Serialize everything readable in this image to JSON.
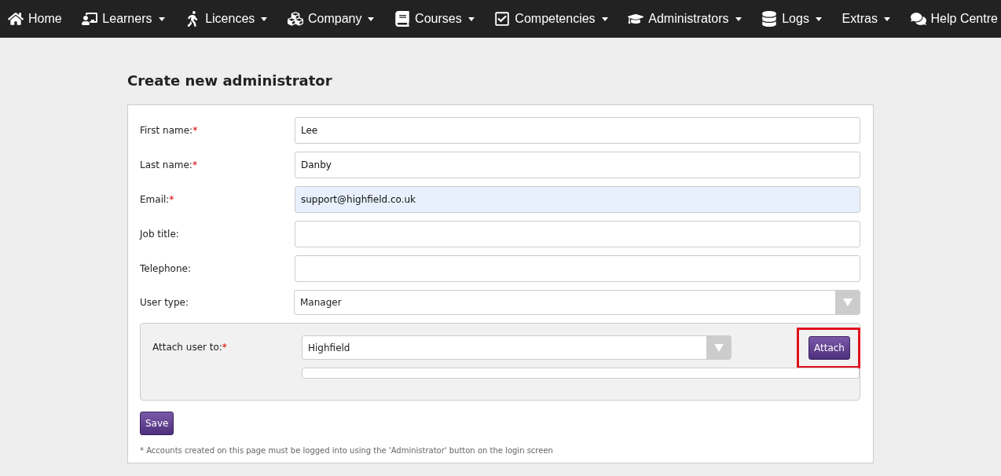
{
  "nav": [
    {
      "label": "Home",
      "dropdown": false
    },
    {
      "label": "Learners",
      "dropdown": true
    },
    {
      "label": "Licences",
      "dropdown": true
    },
    {
      "label": "Company",
      "dropdown": true
    },
    {
      "label": "Courses",
      "dropdown": true
    },
    {
      "label": "Competencies",
      "dropdown": true
    },
    {
      "label": "Administrators",
      "dropdown": true
    },
    {
      "label": "Logs",
      "dropdown": true
    },
    {
      "label": "Extras",
      "dropdown": true
    },
    {
      "label": "Help Centre",
      "dropdown": false
    }
  ],
  "title": "Create new administrator",
  "fields": [
    {
      "kind": "text",
      "label": "First name:",
      "required_mark": "*",
      "value": "Lee",
      "autofilled": false
    },
    {
      "kind": "text",
      "label": "Last name:",
      "required_mark": "*",
      "value": "Danby",
      "autofilled": false
    },
    {
      "kind": "text",
      "label": "Email:",
      "required_mark": "*",
      "value": "support@highfield.co.uk",
      "autofilled": true
    },
    {
      "kind": "text",
      "label": "Job title:",
      "autofilled": false
    },
    {
      "kind": "text",
      "label": "Telephone:",
      "autofilled": false
    },
    {
      "kind": "select",
      "label": "User type:",
      "value": "Manager"
    }
  ],
  "attach": {
    "label": "Attach user to:",
    "required_mark": "*",
    "value": "Highfield",
    "button": "Attach",
    "highlighted": true
  },
  "save_button": "Save",
  "footnote": "* Accounts created on this page must be logged into using the 'Administrator' button on the login screen"
}
